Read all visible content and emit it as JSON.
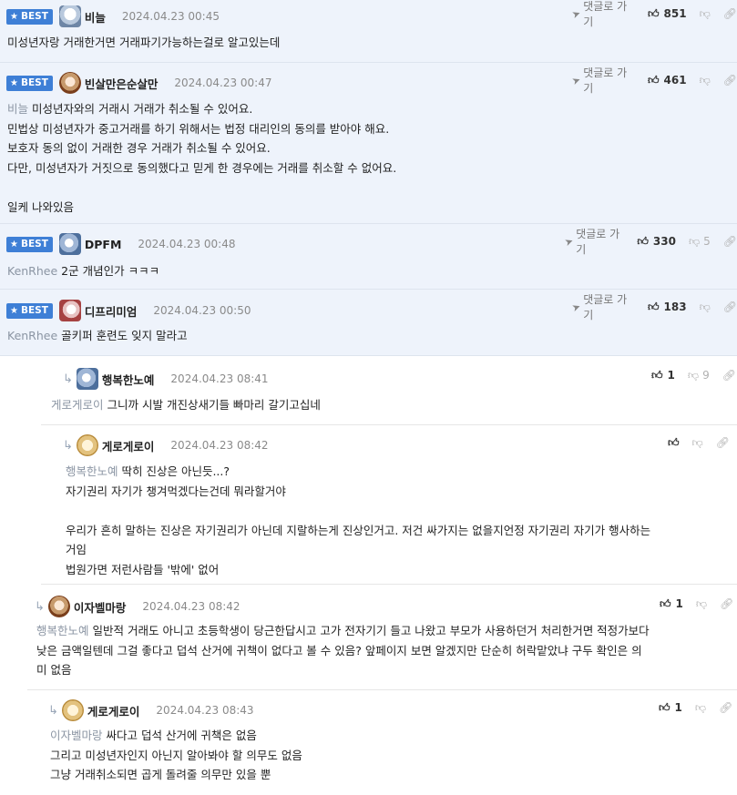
{
  "labels": {
    "best": "BEST",
    "goto_comment": "댓글로 가기"
  },
  "comments": [
    {
      "nick": "비늘",
      "date": "2024.04.23 00:45",
      "likes": "851",
      "dislikes": "",
      "lines": [
        "미성년자랑 거래한거면 거래파기가능하는걸로 알고있는데"
      ]
    },
    {
      "nick": "빈살만은순살만",
      "date": "2024.04.23 00:47",
      "likes": "461",
      "dislikes": "",
      "mention": "비늘",
      "lines": [
        "미성년자와의 거래시 거래가 취소될 수 있어요.",
        "민법상 미성년자가 중고거래를 하기 위해서는 법정 대리인의 동의를 받아야 해요.",
        "보호자 동의 없이 거래한 경우 거래가 취소될 수 있어요.",
        "다만, 미성년자가 거짓으로 동의했다고 믿게 한 경우에는 거래를 취소할 수 없어요.",
        "",
        "일케 나와있음"
      ]
    },
    {
      "nick": "DPFM",
      "date": "2024.04.23 00:48",
      "likes": "330",
      "dislikes": "5",
      "mention": "KenRhee",
      "lines": [
        "2군 개념인가 ㅋㅋㅋ"
      ]
    },
    {
      "nick": "디프리미엄",
      "date": "2024.04.23 00:50",
      "likes": "183",
      "dislikes": "",
      "mention": "KenRhee",
      "lines": [
        "골키퍼 훈련도 잊지 말라고"
      ]
    }
  ],
  "replies": [
    {
      "nick": "행복한노예",
      "date": "2024.04.23 08:41",
      "likes": "1",
      "dislikes": "9",
      "mention": "게로게로이",
      "lines": [
        "그니까 시발 개진상새기들 빠마리 갈기고십네"
      ]
    },
    {
      "nick": "게로게로이",
      "date": "2024.04.23 08:42",
      "likes": "",
      "dislikes": "",
      "mention": "행복한노예",
      "lines": [
        "딱히 진상은 아닌듯...?",
        "자기권리 자기가 챙겨먹겠다는건데 뭐라할거야",
        "",
        "우리가 흔히 말하는 진상은 자기권리가 아닌데 지랄하는게 진상인거고. 저건 싸가지는 없을지언정 자기권리 자기가 행사하는",
        "거임",
        "법원가면 저런사람들 '밖에' 없어"
      ]
    },
    {
      "nick": "이자벨마랑",
      "date": "2024.04.23 08:42",
      "likes": "1",
      "dislikes": "",
      "mention": "행복한노예",
      "lines": [
        "일반적 거래도 아니고 초등학생이 당근한답시고 고가 전자기기 들고 나왔고 부모가 사용하던거 처리한거면 적정가보다",
        "낮은 금액일텐데 그걸 좋다고 덥석 산거에 귀책이 없다고 볼 수 있음? 앞페이지 보면 알겠지만 단순히 허락맡았냐 구두 확인은 의",
        "미 없음"
      ]
    },
    {
      "nick": "게로게로이",
      "date": "2024.04.23 08:43",
      "likes": "1",
      "dislikes": "",
      "mention": "이자벨마랑",
      "lines": [
        "싸다고 덥석 산거에 귀책은 없음",
        "그리고 미성년자인지 아닌지 알아봐야 할 의무도 없음",
        "그냥 거래취소되면 곱게 돌려줄 의무만 있을 뿐"
      ]
    }
  ]
}
